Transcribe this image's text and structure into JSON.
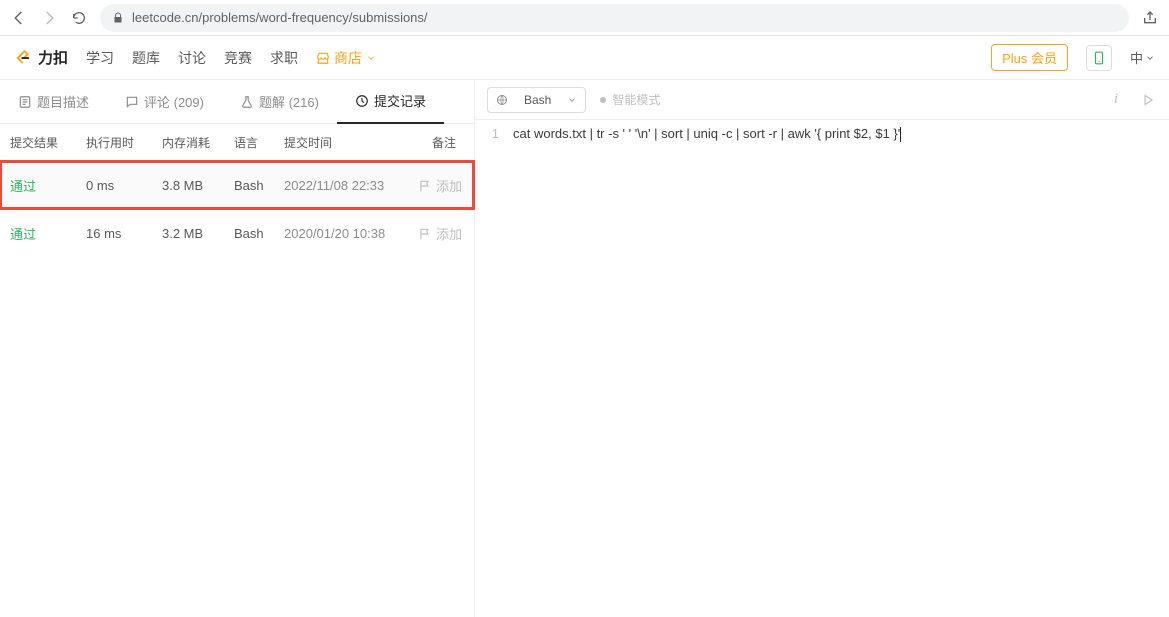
{
  "browser": {
    "url": "leetcode.cn/problems/word-frequency/submissions/"
  },
  "header": {
    "brand": "力扣",
    "nav": {
      "learn": "学习",
      "problems": "题库",
      "discuss": "讨论",
      "contest": "竞赛",
      "jobs": "求职",
      "store": "商店"
    },
    "plus": "Plus 会员",
    "lang": "中"
  },
  "ptabs": {
    "desc": "题目描述",
    "comments": "评论 (209)",
    "solutions": "题解 (216)",
    "submissions": "提交记录"
  },
  "sub_head": {
    "result": "提交结果",
    "runtime": "执行用时",
    "memory": "内存消耗",
    "lang": "语言",
    "date": "提交时间",
    "note": "备注"
  },
  "submissions": [
    {
      "result": "通过",
      "runtime": "0 ms",
      "memory": "3.8 MB",
      "lang": "Bash",
      "date": "2022/11/08 22:33",
      "note": "添加",
      "highlight": true
    },
    {
      "result": "通过",
      "runtime": "16 ms",
      "memory": "3.2 MB",
      "lang": "Bash",
      "date": "2020/01/20 10:38",
      "note": "添加",
      "highlight": false
    }
  ],
  "editor": {
    "language": "Bash",
    "smart": "智能模式",
    "code": "cat words.txt | tr -s ' ' '\\n' | sort | uniq -c | sort -r | awk '{ print $2, $1 }'",
    "line": "1"
  },
  "chart_data": {
    "type": "table",
    "columns": [
      "提交结果",
      "执行用时",
      "内存消耗",
      "语言",
      "提交时间"
    ],
    "rows": [
      [
        "通过",
        "0 ms",
        "3.8 MB",
        "Bash",
        "2022/11/08 22:33"
      ],
      [
        "通过",
        "16 ms",
        "3.2 MB",
        "Bash",
        "2020/01/20 10:38"
      ]
    ]
  }
}
